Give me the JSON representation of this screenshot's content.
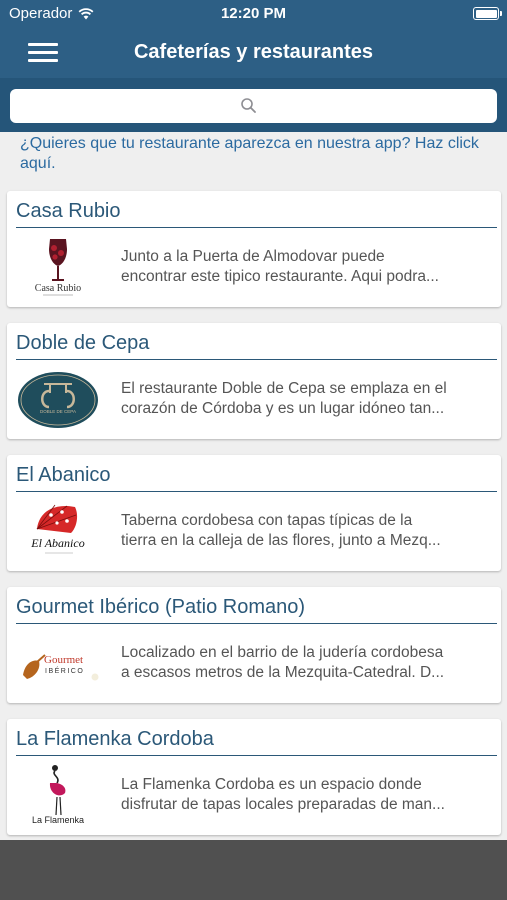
{
  "status_bar": {
    "carrier": "Operador",
    "time": "12:20 PM"
  },
  "nav": {
    "title": "Cafeterías y restaurantes",
    "menu_icon": "hamburger-menu-icon"
  },
  "search": {
    "placeholder": "",
    "icon": "search-icon"
  },
  "promo_link": "¿Quieres que tu restaurante aparezca en nuestra app? Haz click aquí.",
  "restaurants": [
    {
      "name": "Casa Rubio",
      "logo_text": "Casa Rubio",
      "desc_line1": "Junto a la Puerta de Almodovar puede",
      "desc_line2": "encontrar este tipico restaurante. Aqui podra..."
    },
    {
      "name": "Doble de Cepa",
      "logo_text": "DOBLE DE CEPA",
      "desc_line1": "El restaurante Doble de Cepa se emplaza en el",
      "desc_line2": "corazón de Córdoba y es un lugar idóneo tan..."
    },
    {
      "name": "El Abanico",
      "logo_text": "El Abanico",
      "desc_line1": "Taberna cordobesa con tapas típicas de la",
      "desc_line2": "tierra en la calleja de las flores, junto a Mezq..."
    },
    {
      "name": "Gourmet Ibérico (Patio Romano)",
      "logo_text": "Gourmet",
      "logo_text2": "IBÉRICO",
      "desc_line1": "Localizado en el barrio de la judería cordobesa",
      "desc_line2": "a escasos metros de la Mezquita-Catedral. D..."
    },
    {
      "name": "La Flamenka Cordoba",
      "logo_text": "La Flamenka",
      "desc_line1": "La Flamenka Cordoba es un espacio donde",
      "desc_line2": "disfrutar de tapas locales preparadas de man..."
    }
  ]
}
